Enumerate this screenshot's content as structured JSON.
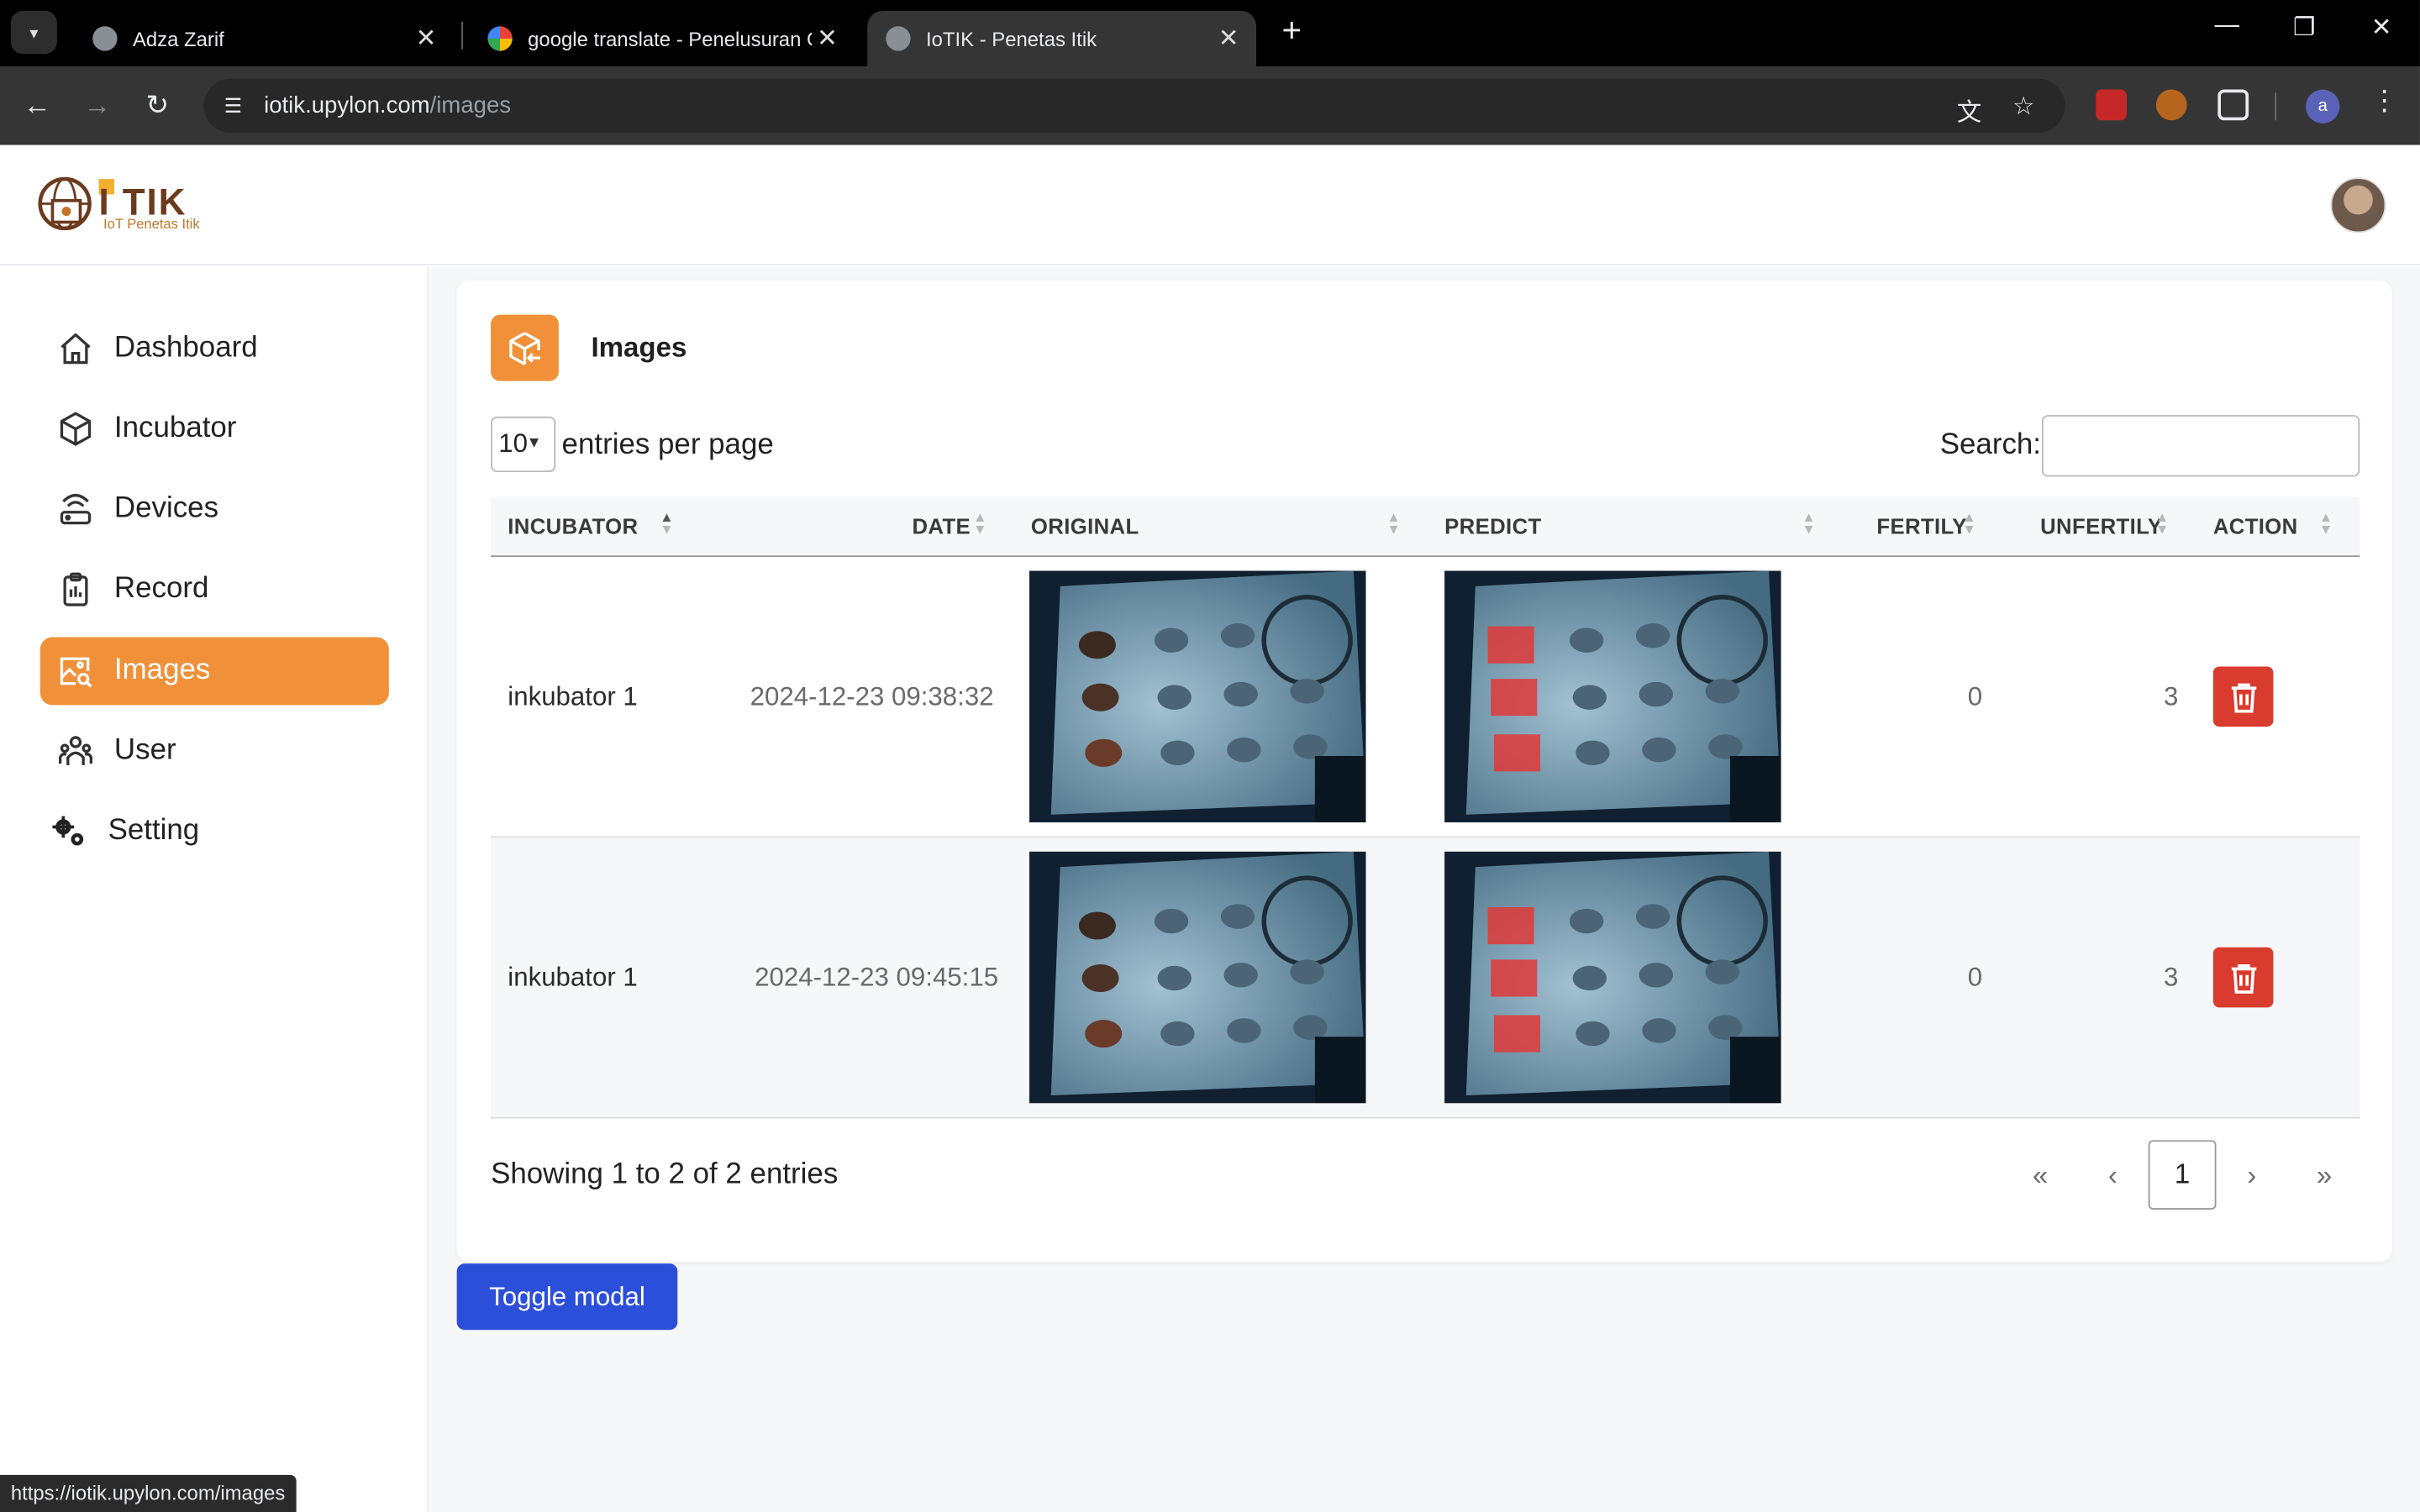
{
  "browser": {
    "tabs": [
      {
        "title": "Adza Zarif",
        "active": false
      },
      {
        "title": "google translate - Penelusuran Google",
        "active": false
      },
      {
        "title": "IoTIK - Penetas Itik",
        "active": true
      }
    ],
    "url_host": "iotik.upylon.com",
    "url_path": "/images",
    "profile_initial": "a",
    "status_url": "https://iotik.upylon.com/images"
  },
  "app": {
    "logo_text": "I TIK",
    "logo_subtitle": "IoT Penetas Itik",
    "accent_color": "#f0913a",
    "danger_color": "#d93c2e",
    "primary_color": "#2c4fd9"
  },
  "sidebar": {
    "items": [
      {
        "label": "Dashboard",
        "icon": "home-icon",
        "active": false
      },
      {
        "label": "Incubator",
        "icon": "box-icon",
        "active": false
      },
      {
        "label": "Devices",
        "icon": "router-icon",
        "active": false
      },
      {
        "label": "Record",
        "icon": "clipboard-icon",
        "active": false
      },
      {
        "label": "Images",
        "icon": "image-search-icon",
        "active": true
      },
      {
        "label": "User",
        "icon": "users-icon",
        "active": false
      },
      {
        "label": "Setting",
        "icon": "gears-icon",
        "active": false
      }
    ]
  },
  "page": {
    "title": "Images",
    "entries_value": "10",
    "entries_label": "entries per page",
    "search_label": "Search:",
    "search_value": "",
    "showing_text": "Showing 1 to 2 of 2 entries",
    "toggle_button": "Toggle modal"
  },
  "table": {
    "headers": [
      "INCUBATOR",
      "DATE",
      "ORIGINAL",
      "PREDICT",
      "FERTILY",
      "UNFERTILY",
      "ACTION"
    ],
    "rows": [
      {
        "incubator": "inkubator 1",
        "date": "2024-12-23 09:38:32",
        "fertily": "0",
        "unfertily": "3"
      },
      {
        "incubator": "inkubator 1",
        "date": "2024-12-23 09:45:15",
        "fertily": "0",
        "unfertily": "3"
      }
    ]
  },
  "pagination": {
    "first": "«",
    "prev": "‹",
    "current": "1",
    "next": "›",
    "last": "»"
  }
}
